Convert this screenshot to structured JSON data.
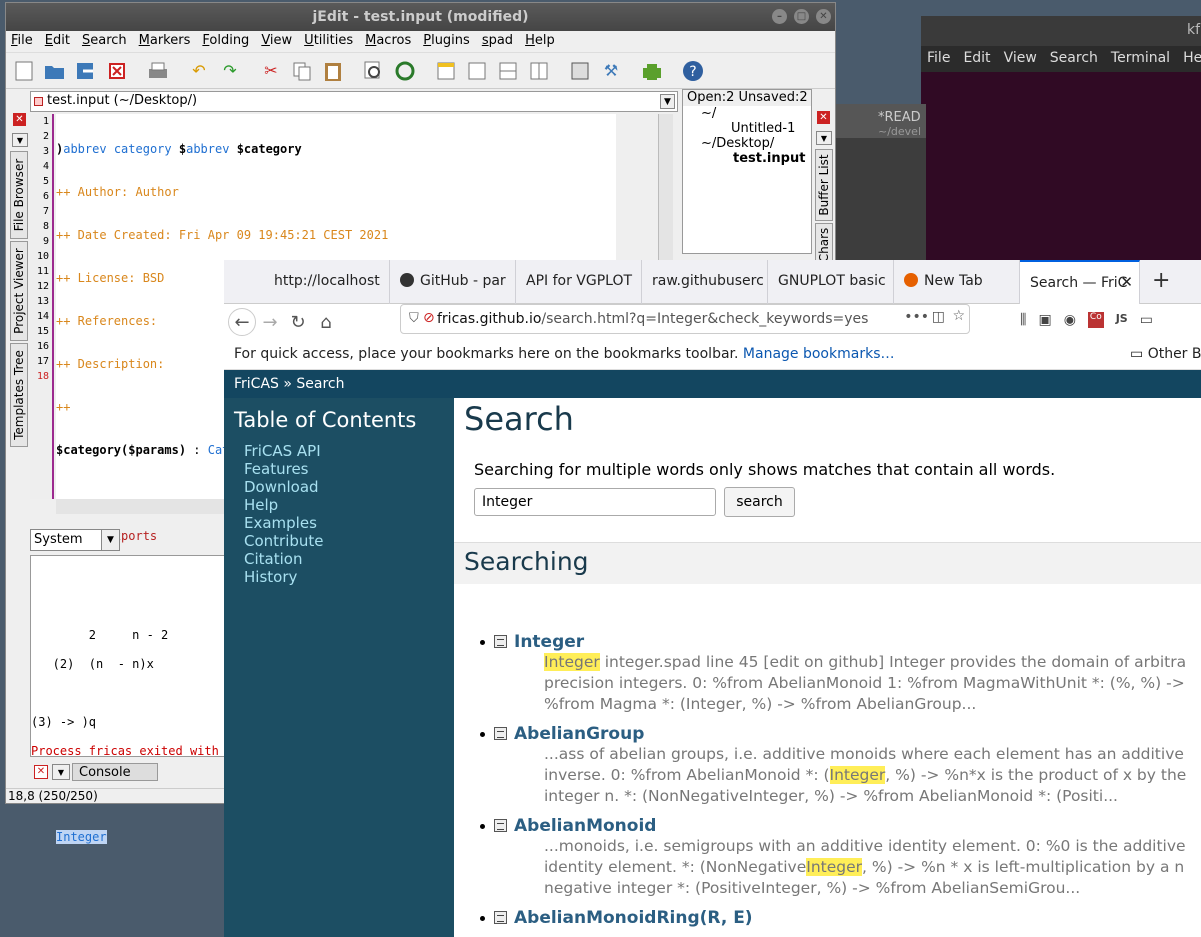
{
  "terminal": {
    "title": "kf",
    "menu": [
      "File",
      "Edit",
      "View",
      "Search",
      "Terminal",
      "Help"
    ]
  },
  "emacs": {
    "title": "*READ",
    "subtitle": "~/devel"
  },
  "jedit": {
    "title": "jEdit - test.input (modified)",
    "menu": [
      "File",
      "Edit",
      "Search",
      "Markers",
      "Folding",
      "View",
      "Utilities",
      "Macros",
      "Plugins",
      "spad",
      "Help"
    ],
    "buffer": "test.input (~/Desktop/)",
    "line_numbers": [
      "1",
      "2",
      "3",
      "4",
      "5",
      "6",
      "7",
      "8",
      "9",
      "10",
      "11",
      "12",
      "13",
      "14",
      "15",
      "16",
      "17",
      "18"
    ],
    "left_tabs": [
      "File Browser",
      "Project Viewer",
      "Templates Tree"
    ],
    "right_tabs": [
      "Buffer List",
      "Chars"
    ],
    "buffer_panel": {
      "header": "Open:2 Unsaved:2",
      "items": [
        "~/",
        "Untitled-1",
        "~/Desktop/",
        "test.input"
      ]
    },
    "system_select": "System",
    "console_tab": "Console",
    "status": "18,8 (250/250)"
  },
  "firefox": {
    "tabs": [
      "http://localhost",
      "GitHub - par",
      "API for VGPLOT",
      "raw.githubuserc",
      "GNUPLOT basic",
      "New Tab",
      "Search — FriC"
    ],
    "url_host": "fricas.github.io",
    "url_path": "/search.html?q=Integer&check_keywords=yes",
    "bookmark_text": "For quick access, place your bookmarks here on the bookmarks toolbar.",
    "bookmark_link": "Manage bookmarks…",
    "other_bookmarks": "Other B",
    "header": "FriCAS » Search",
    "toc_title": "Table of Contents",
    "toc": [
      "FriCAS API",
      "Features",
      "Download",
      "Help",
      "Examples",
      "Contribute",
      "Citation",
      "History"
    ],
    "h1": "Search",
    "info": "Searching for multiple words only shows matches that contain all words.",
    "query": "Integer",
    "search_btn": "search",
    "h2": "Searching"
  }
}
